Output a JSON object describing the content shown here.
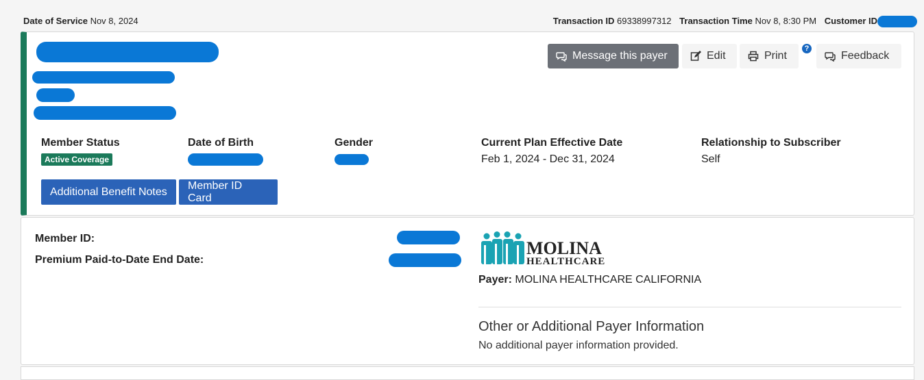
{
  "topbar": {
    "date_of_service_label": "Date of Service",
    "date_of_service": "Nov 8, 2024",
    "transaction_id_label": "Transaction ID",
    "transaction_id": "69338997312",
    "transaction_time_label": "Transaction Time",
    "transaction_time": "Nov 8, 8:30 PM",
    "customer_id_label": "Customer ID"
  },
  "actions": {
    "message": "Message this payer",
    "edit": "Edit",
    "print": "Print",
    "help": "?",
    "feedback": "Feedback"
  },
  "member": {
    "status_label": "Member Status",
    "status": "Active Coverage",
    "dob_label": "Date of Birth",
    "gender_label": "Gender",
    "plan_label": "Current Plan Effective Date",
    "plan_dates": "Feb 1, 2024 - Dec 31, 2024",
    "relationship_label": "Relationship to Subscriber",
    "relationship": "Self",
    "additional_notes_button": "Additional Benefit Notes",
    "id_card_button": "Member ID Card"
  },
  "details": {
    "member_id_label": "Member ID:",
    "premium_label": "Premium Paid-to-Date End Date:",
    "logo_text_1": "MOLINA",
    "logo_text_2": "HEALTHCARE",
    "payer_label": "Payer:",
    "payer_name": "MOLINA HEALTHCARE CALIFORNIA",
    "other_heading": "Other or Additional Payer Information",
    "other_text": "No additional payer information provided."
  },
  "colors": {
    "accent_green": "#1b7a5a",
    "button_blue": "#2b63b8",
    "redaction_blue": "#0a78d6",
    "logo_teal": "#1aa3b3"
  }
}
